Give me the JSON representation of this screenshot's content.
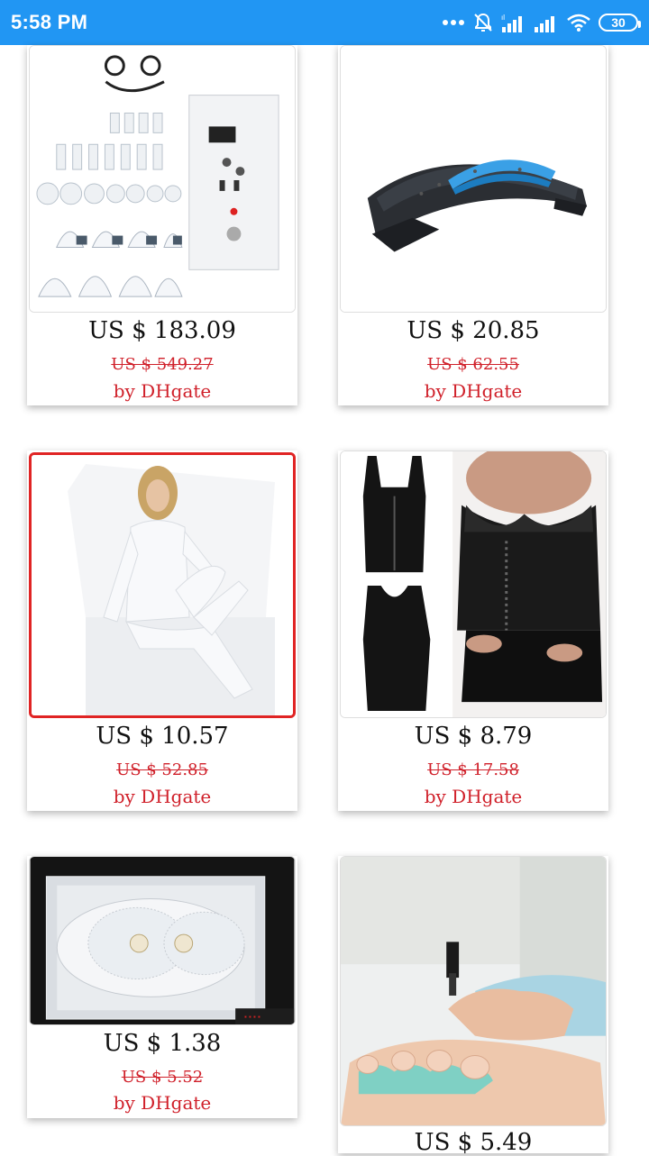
{
  "status_bar": {
    "time": "5:58 PM",
    "battery": "30",
    "icons": [
      "more-dots-icon",
      "alarm-off-icon",
      "signal-icon",
      "signal-icon",
      "wifi-icon",
      "battery-icon"
    ]
  },
  "products": [
    {
      "price": "US $ 183.09",
      "old_price": "US $ 549.27",
      "seller": "by DHgate",
      "image": "vacuum-cupping-machine-image"
    },
    {
      "price": "US $ 20.85",
      "old_price": "US $ 62.55",
      "seller": "by DHgate",
      "image": "back-stretcher-image"
    },
    {
      "price": "US $ 10.57",
      "old_price": "US $ 52.85",
      "seller": "by DHgate",
      "image": "white-bodysuit-image",
      "selected": true
    },
    {
      "price": "US $ 8.79",
      "old_price": "US $ 17.58",
      "seller": "by DHgate",
      "image": "waist-trainer-vest-image"
    },
    {
      "price": "US $ 1.38",
      "old_price": "US $ 5.52",
      "seller": "by DHgate",
      "image": "electrode-pad-image"
    },
    {
      "price": "US $ 5.49",
      "old_price": "",
      "seller": "",
      "image": "toe-separator-pedicure-image"
    }
  ],
  "colors": {
    "status_bar": "#2196f3",
    "price_red": "#d0202a",
    "selected_border": "#e02424"
  }
}
